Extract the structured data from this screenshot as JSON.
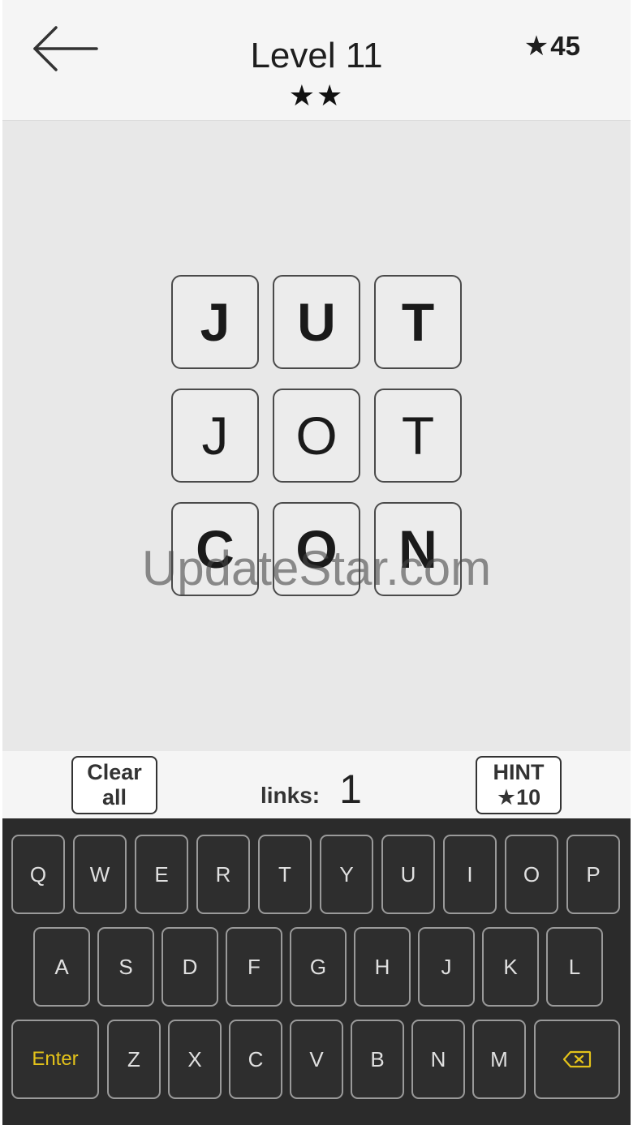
{
  "header": {
    "title": "Level 11",
    "level_stars": "★★",
    "star_icon": "★",
    "star_total": "45"
  },
  "board": {
    "rows": [
      [
        {
          "letter": "J",
          "bold": true
        },
        {
          "letter": "U",
          "bold": true
        },
        {
          "letter": "T",
          "bold": true
        }
      ],
      [
        {
          "letter": "J",
          "bold": false
        },
        {
          "letter": "O",
          "bold": false
        },
        {
          "letter": "T",
          "bold": false
        }
      ],
      [
        {
          "letter": "C",
          "bold": true
        },
        {
          "letter": "O",
          "bold": true
        },
        {
          "letter": "N",
          "bold": true
        }
      ]
    ]
  },
  "watermark": "UpdateStar.com",
  "actions": {
    "clear_line1": "Clear",
    "clear_line2": "all",
    "links_label": "links:",
    "links_value": "1",
    "hint_line1": "HINT",
    "hint_star": "★",
    "hint_cost": "10"
  },
  "keyboard": {
    "row1": [
      "Q",
      "W",
      "E",
      "R",
      "T",
      "Y",
      "U",
      "I",
      "O",
      "P"
    ],
    "row2": [
      "A",
      "S",
      "D",
      "F",
      "G",
      "H",
      "J",
      "K",
      "L"
    ],
    "row3": [
      "Z",
      "X",
      "C",
      "V",
      "B",
      "N",
      "M"
    ],
    "enter_label": "Enter",
    "backspace_icon": "backspace-icon",
    "enter_color": "#e3c21a"
  }
}
